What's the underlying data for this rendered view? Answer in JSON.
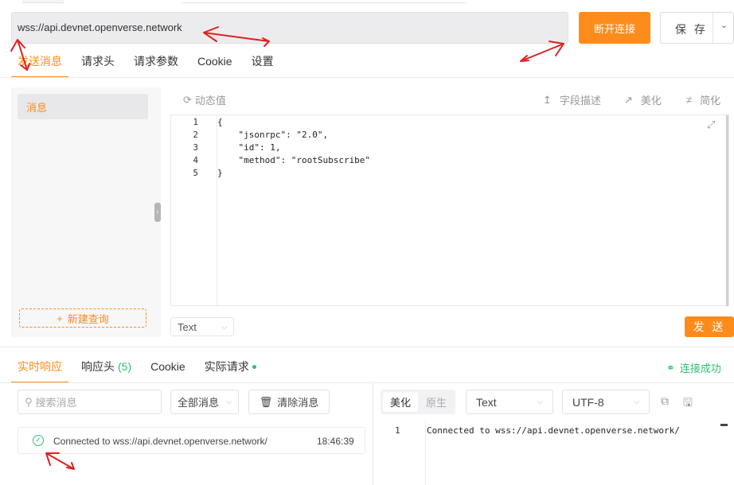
{
  "connection": {
    "url": "wss://api.devnet.openverse.network",
    "disconnect_label": "断开连接",
    "save_label": "保 存"
  },
  "request_tabs": [
    {
      "label": "发送消息",
      "active": true
    },
    {
      "label": "请求头",
      "active": false
    },
    {
      "label": "请求参数",
      "active": false
    },
    {
      "label": "Cookie",
      "active": false
    },
    {
      "label": "设置",
      "active": false
    }
  ],
  "messages": {
    "items": [
      {
        "label": "消息"
      }
    ],
    "new_query_label": "新建查询"
  },
  "editor": {
    "toolbar": {
      "dynamic_value": "动态值",
      "field_desc": "字段描述",
      "beautify": "美化",
      "simplify": "简化"
    },
    "line_numbers": [
      "1",
      "2",
      "3",
      "4",
      "5"
    ],
    "lines": [
      "{",
      "    \"jsonrpc\": \"2.0\",",
      "    \"id\": 1,",
      "    \"method\": \"rootSubscribe\"",
      "}"
    ],
    "format_select": "Text",
    "send_label": "发 送"
  },
  "response_tabs": [
    {
      "label": "实时响应",
      "active": true,
      "count": ""
    },
    {
      "label": "响应头",
      "active": false,
      "count": "(5)"
    },
    {
      "label": "Cookie",
      "active": false,
      "count": ""
    },
    {
      "label": "实际请求",
      "active": false,
      "count": ""
    }
  ],
  "connection_status": "连接成功",
  "response_list": {
    "search_placeholder": "搜索消息",
    "filter": "全部消息",
    "clear_label": "清除消息",
    "rows": [
      {
        "text": "Connected to wss://api.devnet.openverse.network/",
        "time": "18:46:39"
      }
    ]
  },
  "response_view": {
    "beautify": "美化",
    "raw": "原生",
    "type_select": "Text",
    "encoding_select": "UTF-8",
    "line_number": "1",
    "content": "Connected to wss://api.devnet.openverse.network/"
  },
  "colors": {
    "accent": "#ff8b1a",
    "success": "#2fbf71",
    "annotation": "#e02020"
  }
}
